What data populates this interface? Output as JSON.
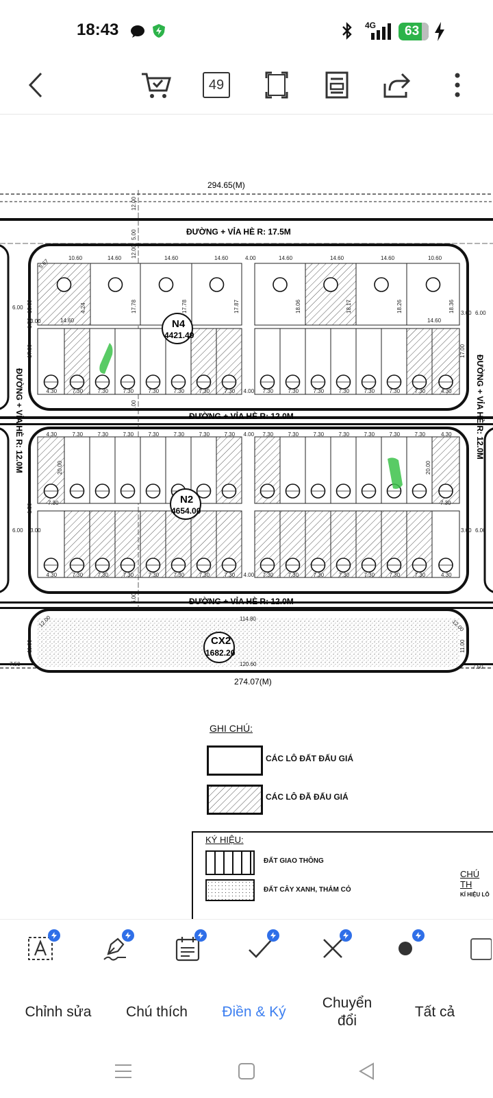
{
  "status": {
    "time": "18:43",
    "network": "4G",
    "battery": "63"
  },
  "toolbar": {
    "page_count": "49"
  },
  "map": {
    "top_dim": "294.65(M)",
    "bottom_dim": "274.07(M)",
    "road_top": "ĐƯỜNG + VỈA HÈ R: 17.5M",
    "road_mid1": "ĐƯỜNG + VỈA HÈ R: 12.0M",
    "road_mid2": "ĐƯỜNG + VỈA HÈ R: 12.0M",
    "road_left": "ĐƯỜNG + VỈA HÈ R: 12.0M",
    "road_right": "ĐƯỜNG + VỈA HÈ R: 12.0M",
    "block_n4_name": "N4",
    "block_n4_area": "4421.49",
    "block_n2_name": "N2",
    "block_n2_area": "4654.00",
    "block_cx2_name": "CX2",
    "block_cx2_area": "1682.20",
    "dims_top_row": [
      "10.60",
      "14.60",
      "14.60",
      "14.60",
      "4.00",
      "14.60",
      "14.60",
      "14.60",
      "10.60"
    ],
    "dims_lot_row": [
      "4.30",
      "7.30",
      "7.30",
      "7.30",
      "7.30",
      "7.30",
      "7.30",
      "7.30",
      "4.00",
      "7.30",
      "7.30",
      "7.30",
      "7.30",
      "7.30",
      "7.30",
      "7.30",
      "4.30"
    ],
    "dims_misc": [
      "17.00",
      "20.00",
      "13.69",
      "5.67",
      "6.00",
      "3.00",
      "1.50",
      "14.60",
      "7.30",
      "114.80",
      "120.60",
      "11.00",
      "12.00",
      "5.00",
      "7.50",
      "12.00",
      "4.24",
      "17.78",
      "17.87",
      "18.06",
      "18.17",
      "18.26",
      "18.36",
      "14.45"
    ]
  },
  "legend": {
    "title": "GHI CHÚ:",
    "item_blank": "CÁC LÔ ĐẤT ĐẤU GIÁ",
    "item_hatched": "CÁC LÔ ĐÃ ĐẤU GIÁ",
    "symbols_title": "KÝ HIỆU:",
    "symbol_traffic": "ĐẤT GIAO THÔNG",
    "symbol_green": "ĐẤT CÂY XANH, THẢM CỎ",
    "side_title": "CHÚ TH",
    "side_text": "KÍ HIỆU LÔ"
  },
  "tools": {
    "items": [
      "text-box",
      "signature",
      "date",
      "check",
      "cross",
      "dot",
      "rectangle"
    ]
  },
  "tabs": {
    "edit": "Chỉnh sửa",
    "annotate": "Chú thích",
    "fill_sign": "Điền & Ký",
    "convert_1": "Chuyển",
    "convert_2": "đổi",
    "all": "Tất cả"
  },
  "colors": {
    "accent": "#3d7ff0",
    "highlight": "#3cc24a",
    "battery": "#2db34a",
    "badge": "#2f6fe8"
  }
}
